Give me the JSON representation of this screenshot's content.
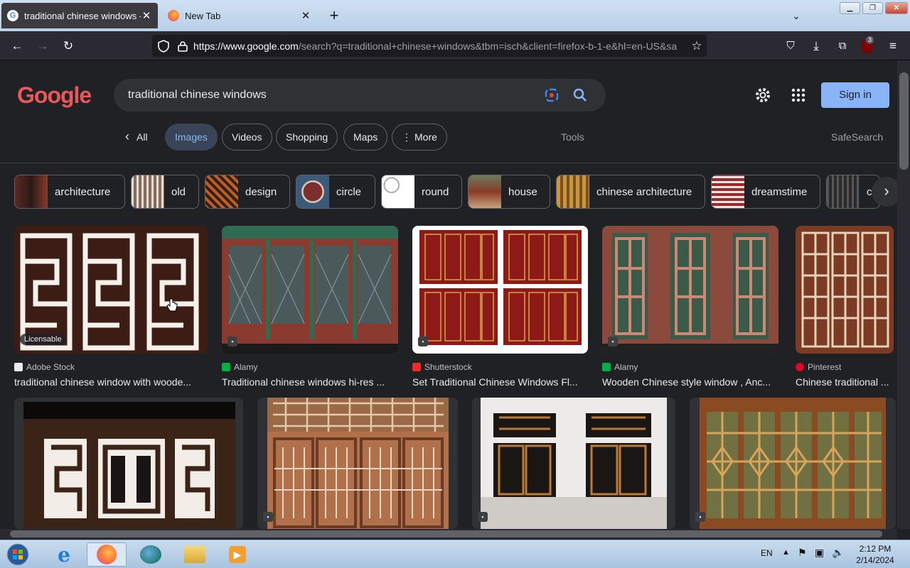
{
  "browser": {
    "tabs": [
      {
        "title": "traditional chinese windows - G",
        "active": true
      },
      {
        "title": "New Tab",
        "active": false
      }
    ],
    "new_tab_label": "+",
    "url": {
      "host": "https://www.google.com",
      "path": "/search?q=traditional+chinese+windows&tbm=isch&client=firefox-b-1-e&hl=en-US&sa"
    },
    "extension_badge": "3"
  },
  "google": {
    "logo": "Google",
    "query": "traditional chinese windows",
    "sign_in": "Sign in",
    "filters": [
      "All",
      "Images",
      "Videos",
      "Shopping",
      "Maps",
      "More"
    ],
    "back_arrow": "‹",
    "more_dots": "⋮",
    "tools": "Tools",
    "safesearch": "SafeSearch",
    "chips": [
      "architecture",
      "old",
      "design",
      "circle",
      "round",
      "house",
      "chinese architecture",
      "dreamstime",
      "c"
    ],
    "results": [
      {
        "source": "Adobe Stock",
        "title": "traditional chinese window with woode...",
        "badge": "Licensable",
        "source_color": "#e8eaed"
      },
      {
        "source": "Alamy",
        "title": "Traditional chinese windows hi-res ...",
        "source_color": "#00b140"
      },
      {
        "source": "Shutterstock",
        "title": "Set Traditional Chinese Windows Fl...",
        "source_color": "#ee2b24"
      },
      {
        "source": "Alamy",
        "title": "Wooden Chinese style window , Anc...",
        "source_color": "#00b140"
      },
      {
        "source": "Pinterest",
        "title": "Chinese traditional ...",
        "source_color": "#e60023"
      }
    ]
  },
  "taskbar": {
    "lang": "EN",
    "time": "2:12 PM",
    "date": "2/14/2024"
  },
  "colors": {
    "accent": "#8ab4f8",
    "background": "#202124"
  }
}
